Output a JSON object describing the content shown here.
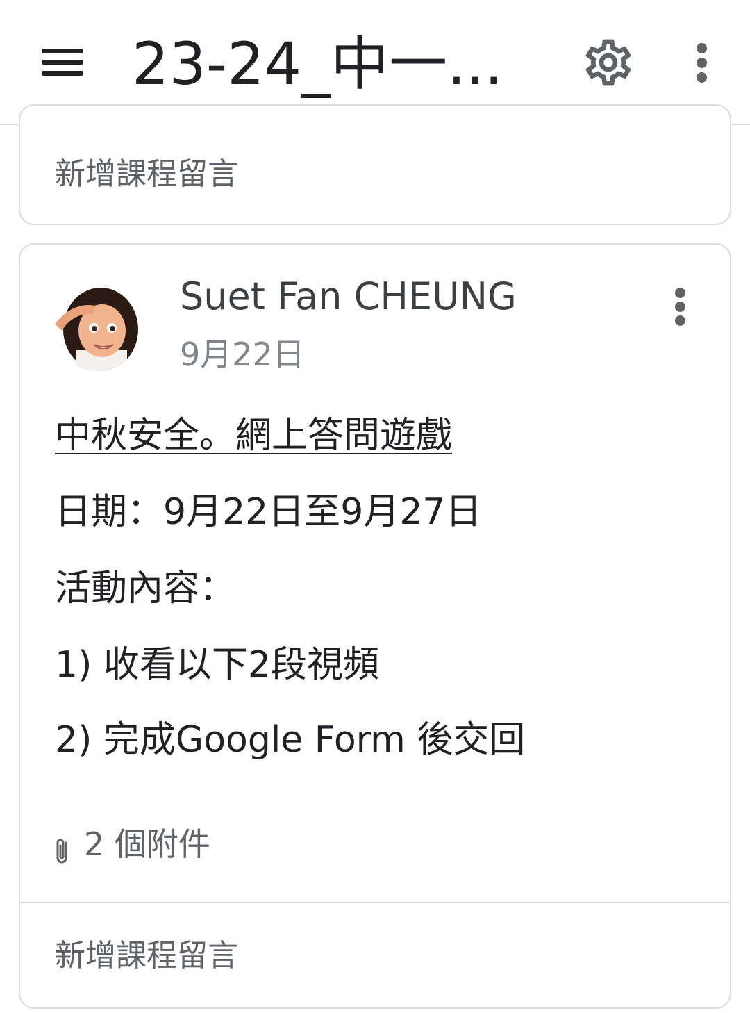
{
  "header": {
    "title": "23-24_中一...",
    "menu_icon": "hamburger-menu-icon",
    "settings_icon": "gear-icon",
    "overflow_icon": "more-vertical-icon"
  },
  "top_card": {
    "comment_placeholder": "新增課程留言"
  },
  "post": {
    "author": "Suet Fan CHEUNG",
    "date": "9月22日",
    "avatar_icon": "avatar-memoji",
    "menu_icon": "more-vertical-icon",
    "link_text": "中秋安全。網上答問遊戲",
    "lines": [
      "日期：9月22日至9月27日",
      "活動內容：",
      "1) 收看以下2段視頻",
      "2) 完成Google Form 後交回"
    ],
    "attachments_icon": "paperclip-icon",
    "attachments_label": "2 個附件",
    "comment_placeholder": "新增課程留言"
  },
  "colors": {
    "text_primary": "#202124",
    "text_secondary": "#5f6368",
    "border": "#dadce0"
  }
}
